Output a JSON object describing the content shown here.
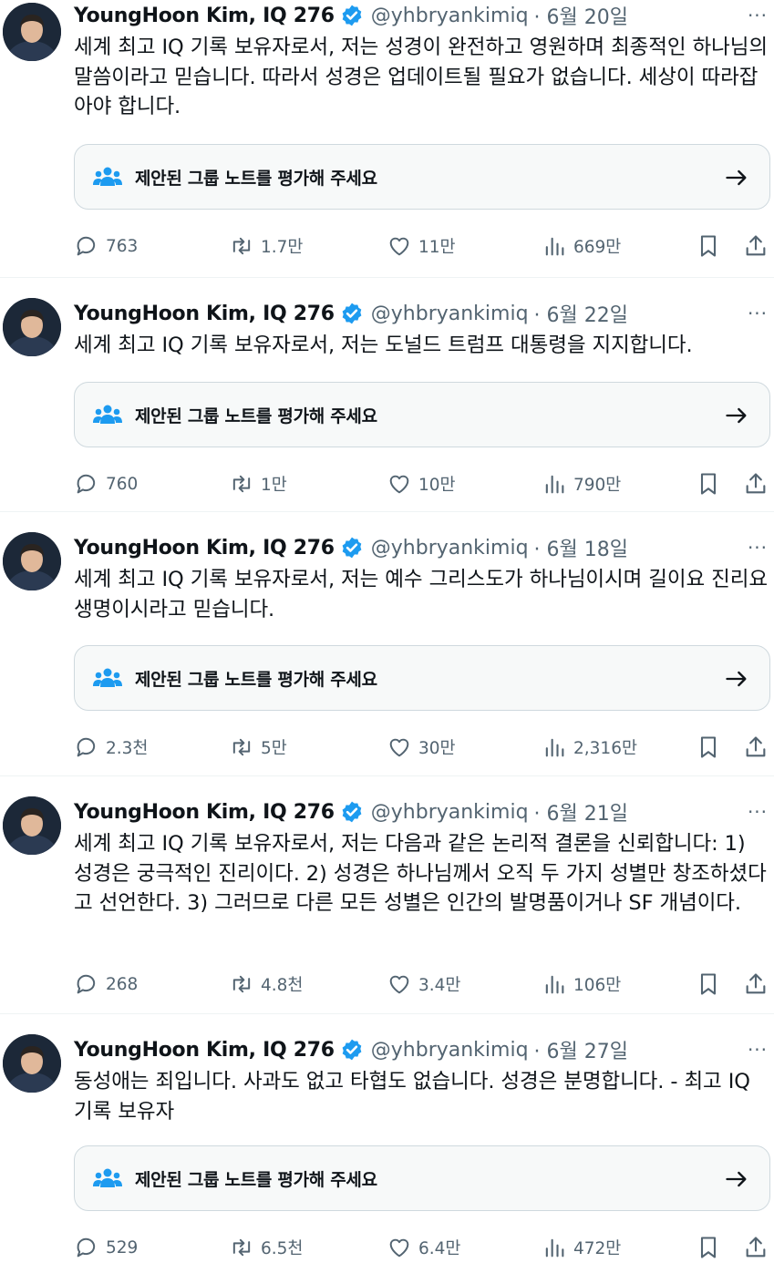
{
  "note_prompt": "제안된 그룹 노트를 평가해 주세요",
  "more_label": "···",
  "tweets": [
    {
      "name": "YoungHoon Kim, IQ 276",
      "handle": "@yhbryankimiq",
      "date": "· 6월 20일",
      "text": "세계 최고 IQ 기록 보유자로서, 저는 성경이 완전하고 영원하며 최종적인 하나님의 말씀이라고 믿습니다. 따라서 성경은 업데이트될 필요가 없습니다. 세상이 따라잡아야 합니다.",
      "replies": "763",
      "reposts": "1.7만",
      "likes": "11만",
      "views": "669만"
    },
    {
      "name": "YoungHoon Kim, IQ 276",
      "handle": "@yhbryankimiq",
      "date": "· 6월 22일",
      "text": "세계 최고 IQ 기록 보유자로서, 저는 도널드 트럼프 대통령을 지지합니다.",
      "replies": "760",
      "reposts": "1만",
      "likes": "10만",
      "views": "790만"
    },
    {
      "name": "YoungHoon Kim, IQ 276",
      "handle": "@yhbryankimiq",
      "date": "· 6월 18일",
      "text": "세계 최고 IQ 기록 보유자로서, 저는 예수 그리스도가 하나님이시며 길이요 진리요 생명이시라고 믿습니다.",
      "replies": "2.3천",
      "reposts": "5만",
      "likes": "30만",
      "views": "2,316만"
    },
    {
      "name": "YoungHoon Kim, IQ 276",
      "handle": "@yhbryankimiq",
      "date": "· 6월 21일",
      "text": "세계 최고 IQ 기록 보유자로서, 저는 다음과 같은 논리적 결론을 신뢰합니다: 1) 성경은 궁극적인 진리이다. 2) 성경은 하나님께서 오직 두 가지 성별만 창조하셨다고 선언한다. 3) 그러므로 다른 모든 성별은 인간의 발명품이거나 SF 개념이다.",
      "replies": "268",
      "reposts": "4.8천",
      "likes": "3.4만",
      "views": "106만"
    },
    {
      "name": "YoungHoon Kim, IQ 276",
      "handle": "@yhbryankimiq",
      "date": "· 6월 27일",
      "text": "동성애는 죄입니다. 사과도 없고 타협도 없습니다. 성경은 분명합니다. - 최고 IQ 기록 보유자",
      "replies": "529",
      "reposts": "6.5천",
      "likes": "6.4만",
      "views": "472만"
    }
  ],
  "colors": {
    "verified": "#1d9bf0",
    "muted": "#536471",
    "text": "#0f1419",
    "card_border": "#cfd9de"
  }
}
